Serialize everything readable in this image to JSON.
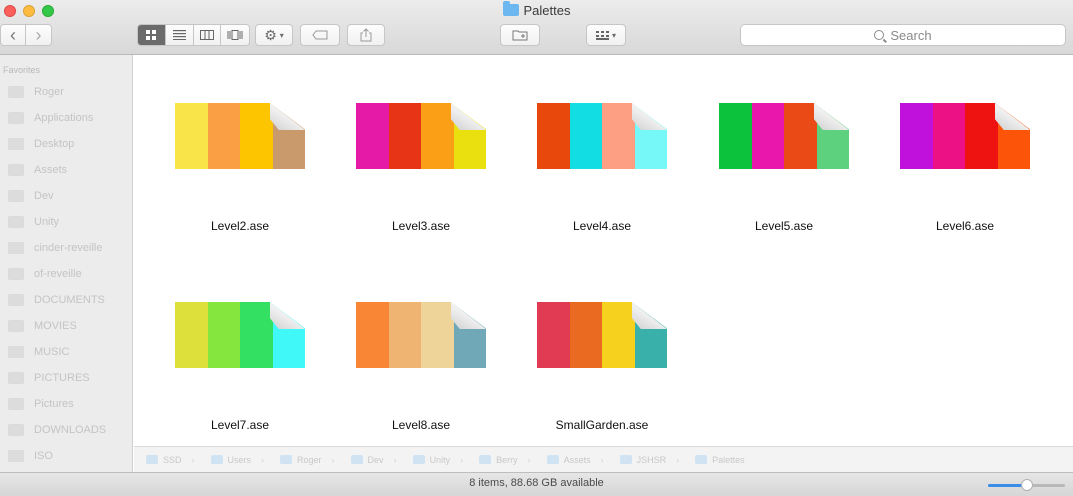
{
  "window": {
    "title": "Palettes"
  },
  "toolbar": {
    "back_glyph": "‹",
    "forward_glyph": "›",
    "search_placeholder": "Search"
  },
  "sidebar": {
    "heading": "Favorites",
    "items": [
      {
        "label": "Roger"
      },
      {
        "label": "Applications"
      },
      {
        "label": "Desktop"
      },
      {
        "label": "Assets"
      },
      {
        "label": "Dev"
      },
      {
        "label": "Unity"
      },
      {
        "label": "cinder-reveille"
      },
      {
        "label": "of-reveille"
      },
      {
        "label": "DOCUMENTS"
      },
      {
        "label": "MOVIES"
      },
      {
        "label": "MUSIC"
      },
      {
        "label": "PICTURES"
      },
      {
        "label": "Pictures"
      },
      {
        "label": "DOWNLOADS"
      },
      {
        "label": "ISO"
      }
    ]
  },
  "files": [
    {
      "name": "Level2.ase",
      "colors": [
        "#f9e54a",
        "#fb9f44",
        "#fdc400",
        "#c89a6c"
      ]
    },
    {
      "name": "Level3.ase",
      "colors": [
        "#e51aa6",
        "#e83416",
        "#fba016",
        "#eae00f"
      ]
    },
    {
      "name": "Level4.ase",
      "colors": [
        "#e9480d",
        "#12dde2",
        "#fc9f82",
        "#76f7f8"
      ]
    },
    {
      "name": "Level5.ase",
      "colors": [
        "#0cc23d",
        "#ea17ad",
        "#ea4b16",
        "#5dd17e"
      ]
    },
    {
      "name": "Level6.ase",
      "colors": [
        "#c010dc",
        "#ec1184",
        "#ee1310",
        "#fc5509"
      ]
    },
    {
      "name": "Level7.ase",
      "colors": [
        "#dde03a",
        "#85e73d",
        "#33e062",
        "#3ff8f7"
      ]
    },
    {
      "name": "Level8.ase",
      "colors": [
        "#f98634",
        "#f0b472",
        "#efd49a",
        "#70a8b8"
      ]
    },
    {
      "name": "SmallGarden.ase",
      "colors": [
        "#e13b53",
        "#ea6a22",
        "#f6d21f",
        "#39b0a9"
      ]
    }
  ],
  "pathbar": {
    "items": [
      {
        "label": "SSD"
      },
      {
        "label": "Users"
      },
      {
        "label": "Roger"
      },
      {
        "label": "Dev"
      },
      {
        "label": "Unity"
      },
      {
        "label": "Berry"
      },
      {
        "label": "Assets"
      },
      {
        "label": "JSHSR"
      },
      {
        "label": "Palettes"
      }
    ]
  },
  "status": {
    "text": "8 items, 88.68 GB available",
    "icon_size_level": 0.5
  },
  "colors": {
    "accent": "#3b8ee8",
    "folder": "#6cb7ef"
  }
}
